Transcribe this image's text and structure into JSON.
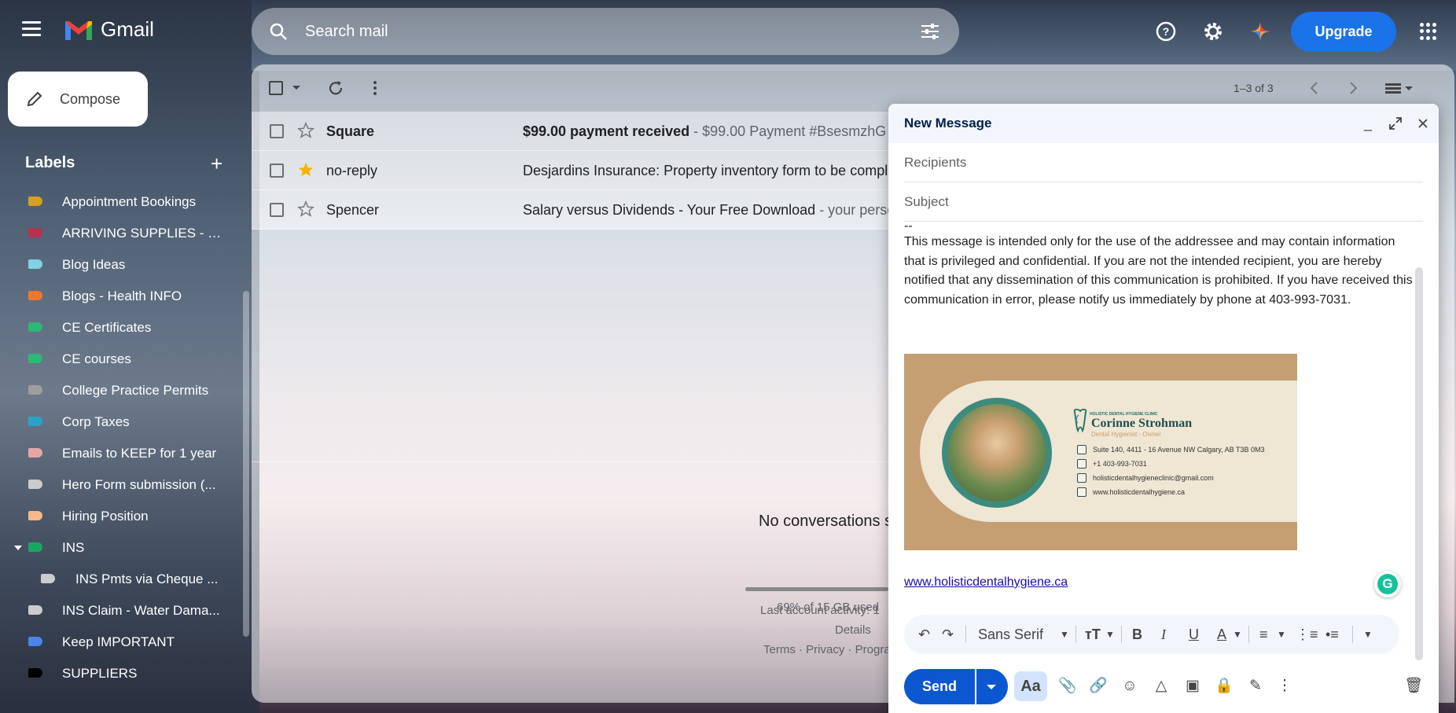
{
  "header": {
    "app_name": "Gmail",
    "search_placeholder": "Search mail",
    "upgrade_label": "Upgrade"
  },
  "sidebar": {
    "compose_label": "Compose",
    "labels_title": "Labels",
    "labels_add": "+",
    "labels": [
      {
        "name": "Appointment Bookings",
        "color": "#d4a022"
      },
      {
        "name": "ARRIVING SUPPLIES - O...",
        "color": "#b7304e"
      },
      {
        "name": "Blog Ideas",
        "color": "#7fd3e3"
      },
      {
        "name": "Blogs - Health INFO",
        "color": "#f2772a"
      },
      {
        "name": "CE Certificates",
        "color": "#2cb876"
      },
      {
        "name": "CE courses",
        "color": "#2cb876"
      },
      {
        "name": "College Practice Permits",
        "color": "#9e9e9e"
      },
      {
        "name": "Corp Taxes",
        "color": "#2aa3c7"
      },
      {
        "name": "Emails to KEEP for 1 year",
        "color": "#e6a5a9"
      },
      {
        "name": "Hero Form submission (...",
        "color": "#cccccc"
      },
      {
        "name": "Hiring Position",
        "color": "#f8b98a"
      },
      {
        "name": "INS",
        "color": "#16a765"
      },
      {
        "name": "INS Pmts via Cheque ...",
        "color": "#cccccc"
      },
      {
        "name": "INS Claim - Water Dama...",
        "color": "#cccccc"
      },
      {
        "name": "Keep IMPORTANT",
        "color": "#4a86e8"
      },
      {
        "name": "SUPPLIERS",
        "color": "#000000"
      }
    ]
  },
  "toolbar": {
    "pager": "1–3 of 3"
  },
  "emails": [
    {
      "sender": "Square",
      "subject": "$99.00 payment received",
      "snippet": " - $99.00 Payment #BsesmzhG",
      "starred": false,
      "unread": true
    },
    {
      "sender": "no-reply",
      "subject": "Desjardins Insurance: Property inventory form to be comple",
      "snippet": "",
      "starred": true,
      "unread": false
    },
    {
      "sender": "Spencer",
      "subject": "Salary versus Dividends - Your Free Download",
      "snippet": " - your perso",
      "starred": false,
      "unread": false
    }
  ],
  "main": {
    "empty_message": "No conversations s",
    "storage": "69% of 15 GB used",
    "last_activity": "Last account activity: 1",
    "details": "Details",
    "footer_links": "Terms · Privacy · Progra"
  },
  "compose": {
    "title": "New Message",
    "recipients_placeholder": "Recipients",
    "subject_placeholder": "Subject",
    "sig_separator": "--",
    "disclaimer": "This message is intended only for the use of the addressee and may contain information that is privileged and confidential. If you are not the intended recipient, you are hereby notified that any dissemination of this communication is prohibited. If you have received this communication in error, please notify us immediately by phone at 403-993-7031.",
    "signature": {
      "clinic": "HOLISTIC DENTAL HYGIENE CLINIC",
      "name": "Corinne Strohman",
      "role": "Dental Hygienist - Owner",
      "address": "Suite 140, 4411 - 16 Avenue NW Calgary, AB T3B 0M3",
      "phone": "+1 403-993-7031",
      "email": "holisticdentalhygieneclinic@gmail.com",
      "website": "www.holisticdentalhygiene.ca"
    },
    "link": "www.holisticdentalhygiene.ca",
    "font_name": "Sans Serif",
    "send_label": "Send",
    "aa_label": "Aa"
  }
}
